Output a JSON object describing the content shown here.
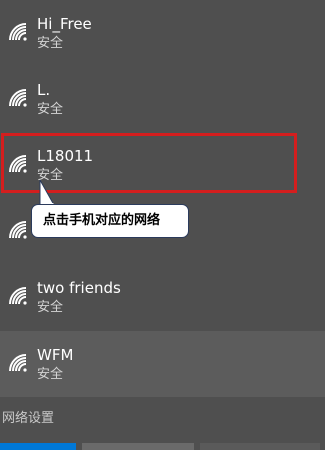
{
  "networks": [
    {
      "name": "Hi_Free",
      "status": "安全"
    },
    {
      "name": "L.",
      "status": "安全"
    },
    {
      "name": "L18011",
      "status": "安全"
    },
    {
      "name": "",
      "status": ""
    },
    {
      "name": "two friends",
      "status": "安全"
    },
    {
      "name": "WFM",
      "status": "安全"
    }
  ],
  "callout": {
    "text": "点击手机对应的网络"
  },
  "settings": {
    "label": "网络设置"
  },
  "colors": {
    "highlight_border": "#d41e1e",
    "accent_button": "#0078d7",
    "background": "#4f4f4f"
  },
  "icons": {
    "network": "wifi-icon"
  }
}
